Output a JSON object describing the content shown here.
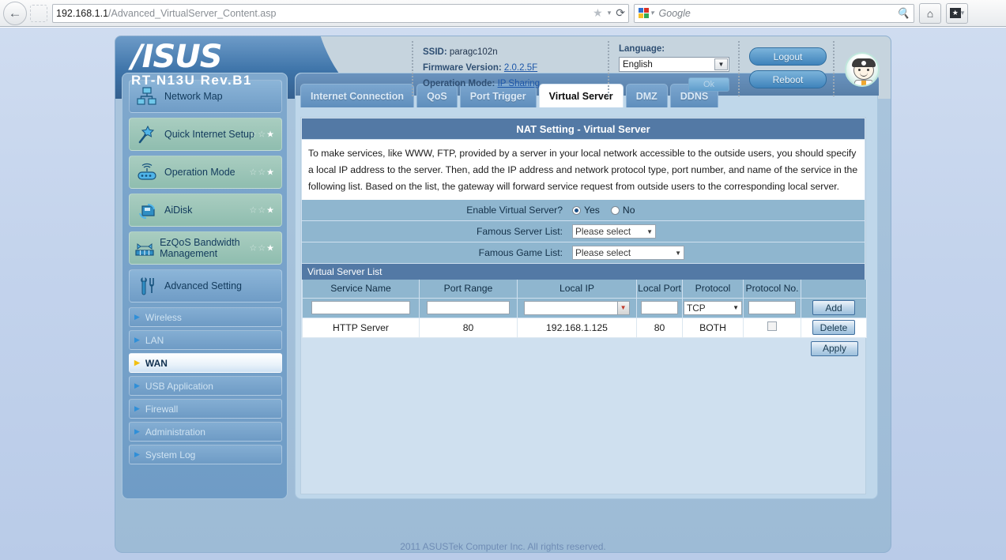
{
  "browser": {
    "back_icon": "back-arrow-icon",
    "url_host": "192.168.1.1",
    "url_path": "/Advanced_VirtualServer_Content.asp",
    "star_icon": "★",
    "caret_icon": "▾",
    "reload_icon": "⟳",
    "search_placeholder": "Google",
    "search_icon": "search-icon",
    "home_icon": "⌂",
    "bookmark_icon": "★"
  },
  "banner": {
    "brand": "/ISUS",
    "model": "RT-N13U Rev.B1",
    "ssid_label": "SSID:",
    "ssid_value": "paragc102n",
    "firmware_label": "Firmware Version:",
    "firmware_value": "2.0.2.5F",
    "opmode_label": "Operation Mode:",
    "opmode_value": "IP Sharing",
    "language_label": "Language:",
    "language_value": "English",
    "ok_button": "Ok",
    "logout_button": "Logout",
    "reboot_button": "Reboot",
    "mascot_icon": "doctor-mascot-icon"
  },
  "sidebar": {
    "main_items": [
      {
        "label": "Network Map",
        "icon": "network-map-icon",
        "style": "blue",
        "stars": 0
      },
      {
        "label": "Quick Internet Setup",
        "icon": "magic-wand-icon",
        "style": "green",
        "stars": 1
      },
      {
        "label": "Operation Mode",
        "icon": "router-icon",
        "style": "green",
        "stars": 3
      },
      {
        "label": "AiDisk",
        "icon": "aidisk-icon",
        "style": "green",
        "stars": 3
      },
      {
        "label": "EzQoS Bandwidth Management",
        "icon": "bandwidth-icon",
        "style": "green",
        "stars": 3
      },
      {
        "label": "Advanced Setting",
        "icon": "tools-icon",
        "style": "blue",
        "stars": 0
      }
    ],
    "sub_items": [
      {
        "label": "Wireless",
        "active": false
      },
      {
        "label": "LAN",
        "active": false
      },
      {
        "label": "WAN",
        "active": true
      },
      {
        "label": "USB Application",
        "active": false
      },
      {
        "label": "Firewall",
        "active": false
      },
      {
        "label": "Administration",
        "active": false
      },
      {
        "label": "System Log",
        "active": false
      }
    ]
  },
  "tabs": [
    {
      "label": "Internet Connection",
      "active": false
    },
    {
      "label": "QoS",
      "active": false
    },
    {
      "label": "Port Trigger",
      "active": false
    },
    {
      "label": "Virtual Server",
      "active": true
    },
    {
      "label": "DMZ",
      "active": false
    },
    {
      "label": "DDNS",
      "active": false
    }
  ],
  "panel": {
    "title": "NAT Setting - Virtual Server",
    "description": "To make services, like WWW, FTP, provided by a server in your local network accessible to the outside users, you should specify a local IP address to the server. Then, add the IP address and network protocol type, port number, and name of the service in the following list. Based on the list, the gateway will forward service request from outside users to the corresponding local server.",
    "settings": [
      {
        "label": "Enable Virtual Server?",
        "type": "radio",
        "options": [
          "Yes",
          "No"
        ],
        "selected": "Yes"
      },
      {
        "label": "Famous Server List:",
        "type": "select",
        "value": "Please select"
      },
      {
        "label": "Famous Game List:",
        "type": "select",
        "value": "Please select"
      }
    ],
    "list_title": "Virtual Server List",
    "columns": [
      "Service Name",
      "Port Range",
      "Local IP",
      "Local Port",
      "Protocol",
      "Protocol No.",
      ""
    ],
    "entry_row": {
      "service_name": "",
      "port_range": "",
      "local_ip": "",
      "local_port": "",
      "protocol": "TCP",
      "protocol_no": "",
      "action": "Add"
    },
    "rows": [
      {
        "service_name": "HTTP Server",
        "port_range": "80",
        "local_ip": "192.168.1.125",
        "local_port": "80",
        "protocol": "BOTH",
        "protocol_no": "",
        "checked": false,
        "action": "Delete"
      }
    ],
    "apply_button": "Apply"
  },
  "footer": "2011 ASUSTek Computer Inc. All rights reserved."
}
